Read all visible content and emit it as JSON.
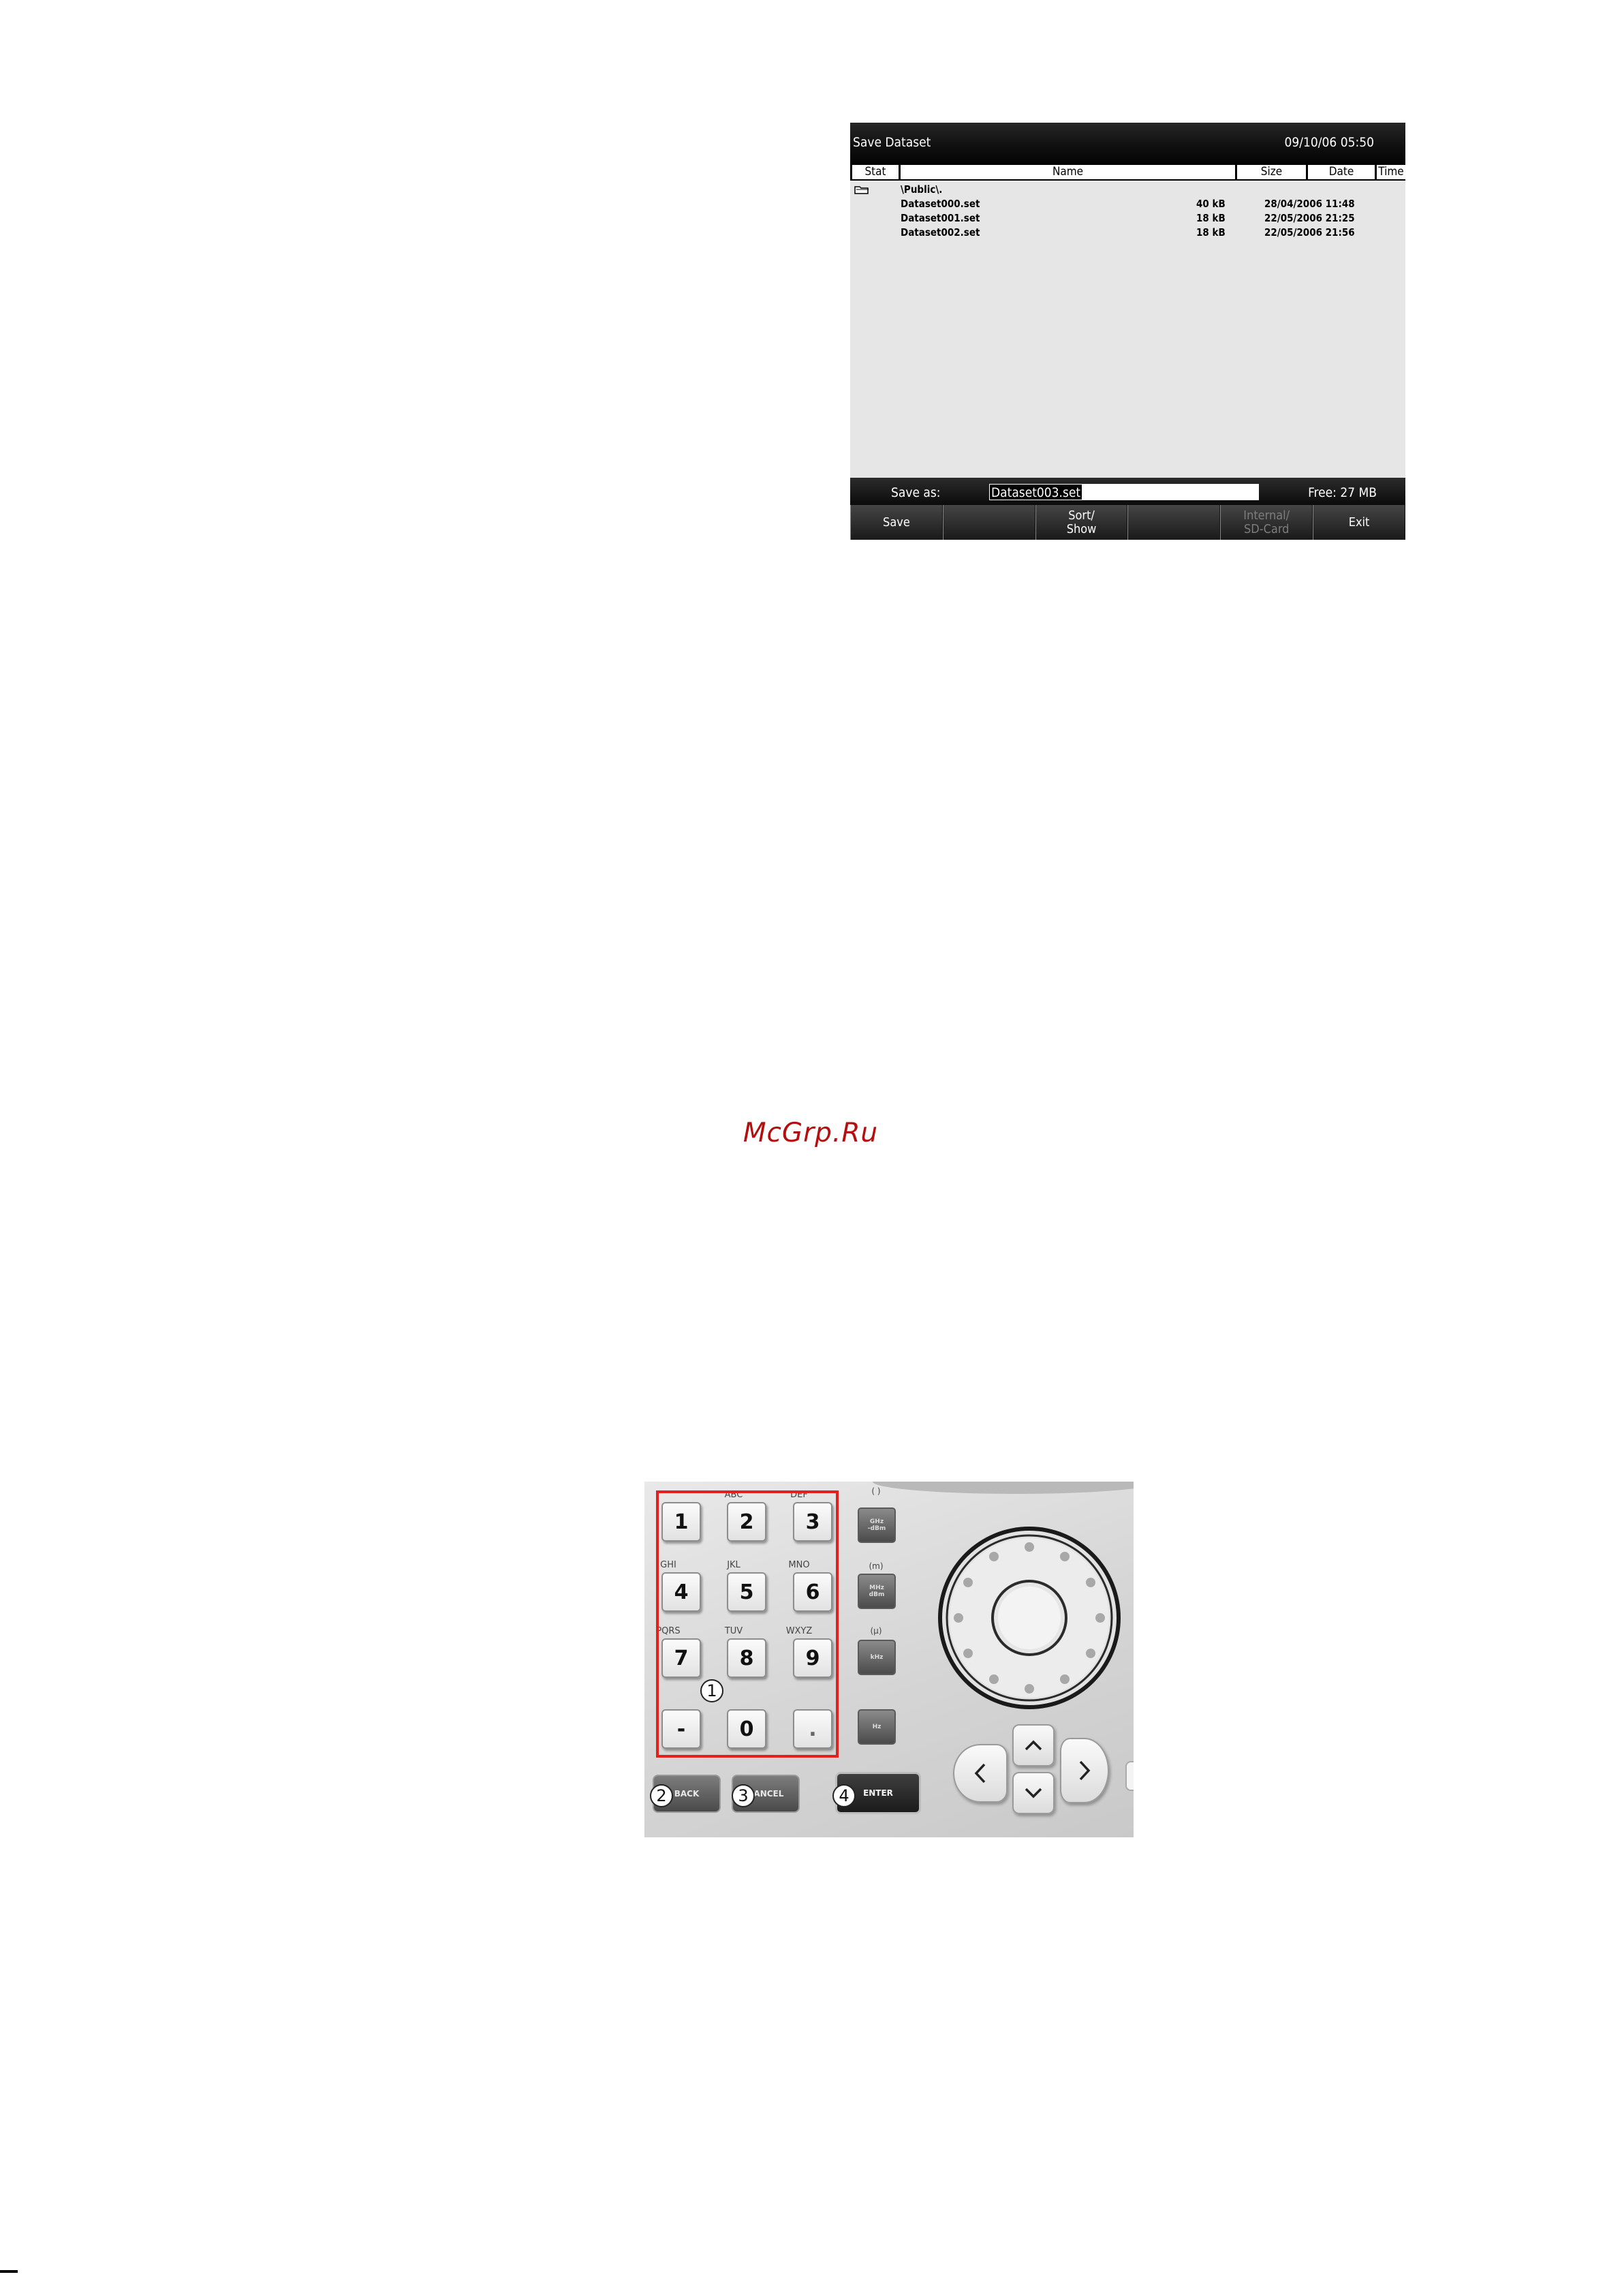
{
  "screen": {
    "title": "Save Dataset",
    "datetime": "09/10/06 05:50",
    "columns": {
      "stat": "Stat",
      "name": "Name",
      "size": "Size",
      "date": "Date",
      "time": "Time"
    },
    "folder": "\\Public\\.",
    "files": [
      {
        "name": "Dataset000.set",
        "size": "40 kB",
        "datetime": "28/04/2006 11:48"
      },
      {
        "name": "Dataset001.set",
        "size": "18 kB",
        "datetime": "22/05/2006 21:25"
      },
      {
        "name": "Dataset002.set",
        "size": "18 kB",
        "datetime": "22/05/2006 21:56"
      }
    ],
    "save_as_label": "Save as:",
    "save_as_value": "Dataset003.set",
    "free_space": "Free: 27 MB",
    "softkeys": [
      {
        "label": "Save",
        "enabled": true
      },
      {
        "label": "",
        "enabled": true
      },
      {
        "label": "Sort/\nShow",
        "enabled": true
      },
      {
        "label": "",
        "enabled": true
      },
      {
        "label": "Internal/\nSD-Card",
        "enabled": false
      },
      {
        "label": "Exit",
        "enabled": true
      }
    ]
  },
  "watermark": "McGrp.Ru",
  "keypad": {
    "keys": [
      "1",
      "2",
      "3",
      "4",
      "5",
      "6",
      "7",
      "8",
      "9",
      "-",
      "0",
      "."
    ],
    "letters": [
      "ABC",
      "DEF",
      "GHI",
      "JKL",
      "MNO",
      "PQRS",
      "TUV",
      "WXYZ"
    ],
    "unit_labels": [
      "( )",
      "(m)",
      "(μ)"
    ],
    "unit_keys": [
      "GHz\n-dBm",
      "MHz\ndBm",
      "kHz",
      "Hz"
    ],
    "function_keys": {
      "back": "BACK",
      "cancel": "CANCEL",
      "enter": "ENTER"
    },
    "callouts": [
      "1",
      "2",
      "3",
      "4"
    ],
    "accent_color": "#e3201e"
  }
}
